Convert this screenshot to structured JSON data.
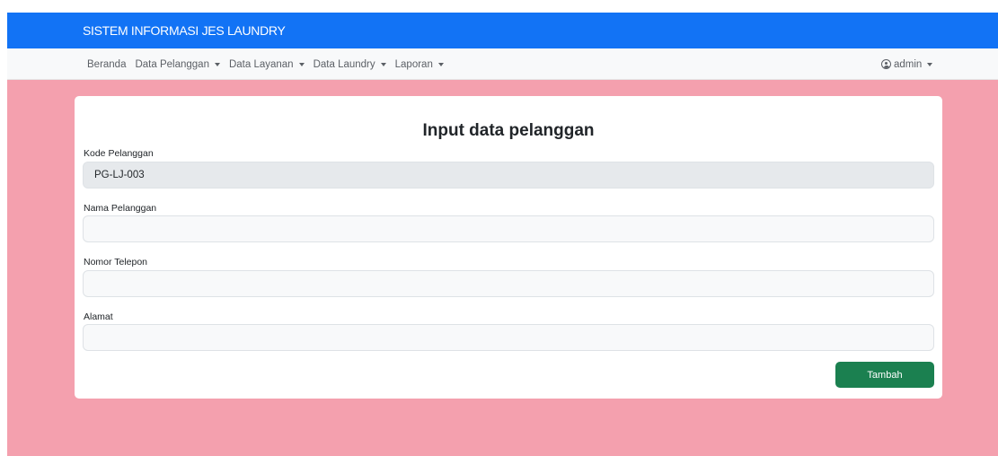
{
  "app": {
    "title": "SISTEM INFORMASI JES LAUNDRY"
  },
  "nav": {
    "items": [
      {
        "label": "Beranda",
        "dropdown": false
      },
      {
        "label": "Data Pelanggan",
        "dropdown": true
      },
      {
        "label": "Data Layanan",
        "dropdown": true
      },
      {
        "label": "Data Laundry",
        "dropdown": true
      },
      {
        "label": "Laporan",
        "dropdown": true
      }
    ],
    "user": {
      "label": "admin",
      "icon": "user-circle-icon"
    }
  },
  "form": {
    "title": "Input data pelanggan",
    "fields": [
      {
        "label": "Kode Pelanggan",
        "value": "PG-LJ-003",
        "readonly": true
      },
      {
        "label": "Nama Pelanggan",
        "value": "",
        "readonly": false
      },
      {
        "label": "Nomor Telepon",
        "value": "",
        "readonly": false
      },
      {
        "label": "Alamat",
        "value": "",
        "readonly": false
      }
    ],
    "submit_label": "Tambah"
  },
  "colors": {
    "header": "#1273f5",
    "navbar": "#f8f9fa",
    "background": "#f4a0ae",
    "card": "#ffffff",
    "submit_button": "#1b8050"
  }
}
